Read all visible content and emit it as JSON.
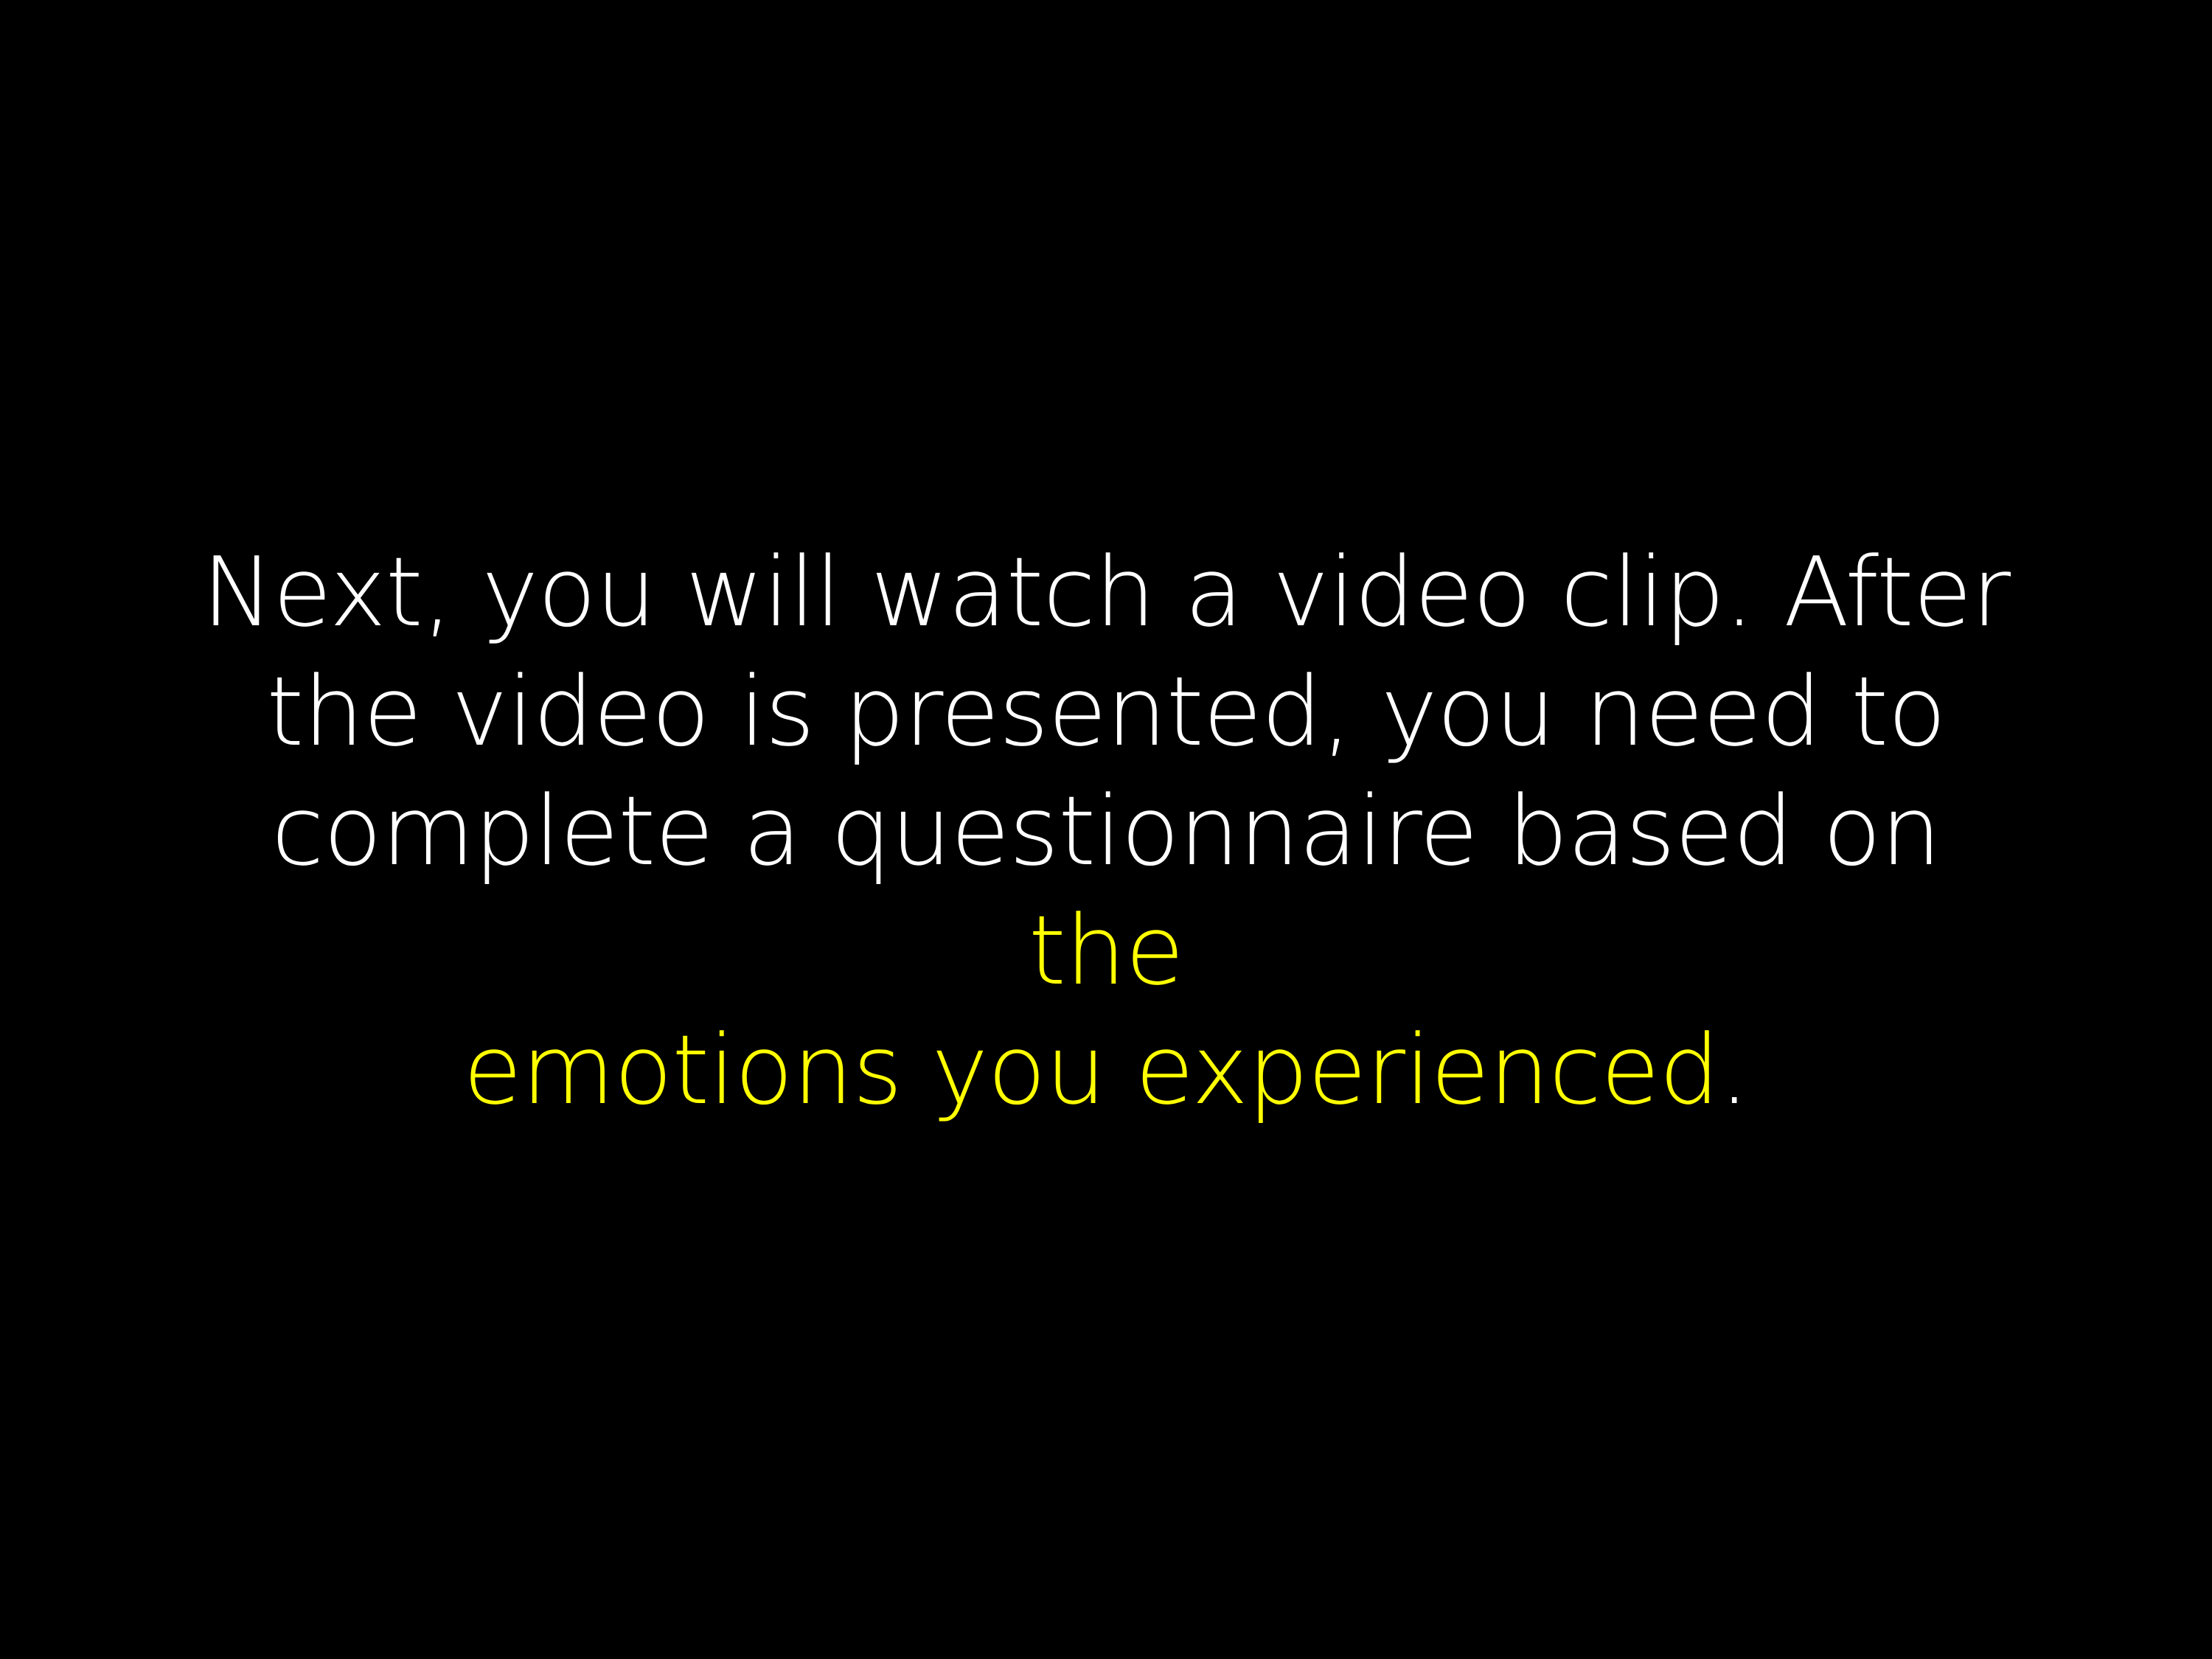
{
  "instruction": {
    "line1": "Next, you will watch a video clip. After",
    "line2": "the video is presented, you need to",
    "line3_plain": "complete a questionnaire based on ",
    "line3_highlight": "the",
    "line4_highlight": "emotions you experienced",
    "line4_end": "."
  },
  "colors": {
    "background": "#000000",
    "text": "#ffffff",
    "highlight": "#ffff00"
  }
}
